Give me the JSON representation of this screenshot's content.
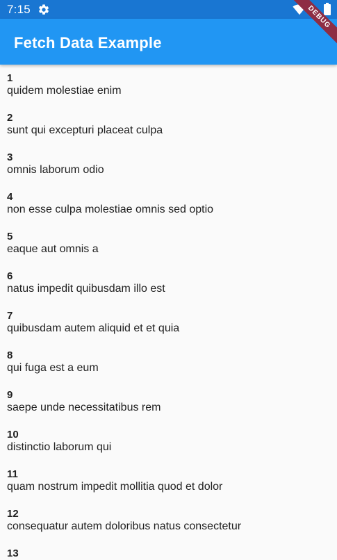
{
  "status_bar": {
    "time": "7:15",
    "icons": [
      "gear-icon",
      "wifi-icon",
      "battery-icon"
    ]
  },
  "debug_banner": {
    "label": "DEBUG"
  },
  "app_bar": {
    "title": "Fetch Data Example",
    "color": "#2196f3"
  },
  "colors": {
    "status_bar": "#1976d2",
    "background": "#fafafa",
    "debug_ribbon": "#8e2d44"
  },
  "items": [
    {
      "id": "1",
      "title": "quidem molestiae enim"
    },
    {
      "id": "2",
      "title": "sunt qui excepturi placeat culpa"
    },
    {
      "id": "3",
      "title": "omnis laborum odio"
    },
    {
      "id": "4",
      "title": "non esse culpa molestiae omnis sed optio"
    },
    {
      "id": "5",
      "title": "eaque aut omnis a"
    },
    {
      "id": "6",
      "title": "natus impedit quibusdam illo est"
    },
    {
      "id": "7",
      "title": "quibusdam autem aliquid et et quia"
    },
    {
      "id": "8",
      "title": "qui fuga est a eum"
    },
    {
      "id": "9",
      "title": "saepe unde necessitatibus rem"
    },
    {
      "id": "10",
      "title": "distinctio laborum qui"
    },
    {
      "id": "11",
      "title": "quam nostrum impedit mollitia quod et dolor"
    },
    {
      "id": "12",
      "title": "consequatur autem doloribus natus consectetur"
    },
    {
      "id": "13",
      "title": ""
    }
  ]
}
